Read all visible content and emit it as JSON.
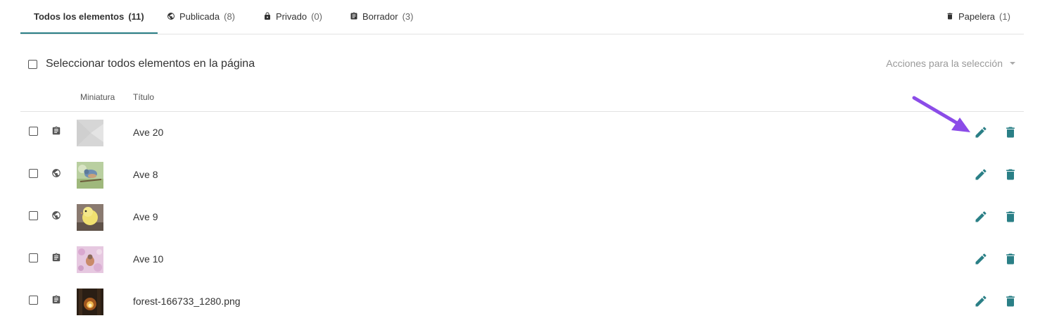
{
  "tabs": [
    {
      "label": "Todos los elementos",
      "count": "(11)",
      "icon": "none"
    },
    {
      "label": "Publicada",
      "count": "(8)",
      "icon": "globe-icon"
    },
    {
      "label": "Privado",
      "count": "(0)",
      "icon": "lock-icon"
    },
    {
      "label": "Borrador",
      "count": "(3)",
      "icon": "clipboard-icon"
    },
    {
      "label": "Papelera",
      "count": "(1)",
      "icon": "trash-icon"
    }
  ],
  "select_all_label": "Seleccionar todos elementos en la página",
  "bulk_actions_label": "Acciones para la selección",
  "columns": {
    "thumbnail": "Miniatura",
    "title": "Título"
  },
  "rows": [
    {
      "title": "Ave 20",
      "status": "clipboard-icon",
      "thumb": "placeholder-gray"
    },
    {
      "title": "Ave 8",
      "status": "globe-icon",
      "thumb": "bird-blue-photo"
    },
    {
      "title": "Ave 9",
      "status": "globe-icon",
      "thumb": "chick-yellow-photo"
    },
    {
      "title": "Ave 10",
      "status": "clipboard-icon",
      "thumb": "bird-pink-flowers-photo"
    },
    {
      "title": "forest-166733_1280.png",
      "status": "clipboard-icon",
      "thumb": "forest-sunlight-photo"
    }
  ],
  "colors": {
    "accent": "#2a7f86",
    "annotation_arrow": "#8b4ce8"
  }
}
